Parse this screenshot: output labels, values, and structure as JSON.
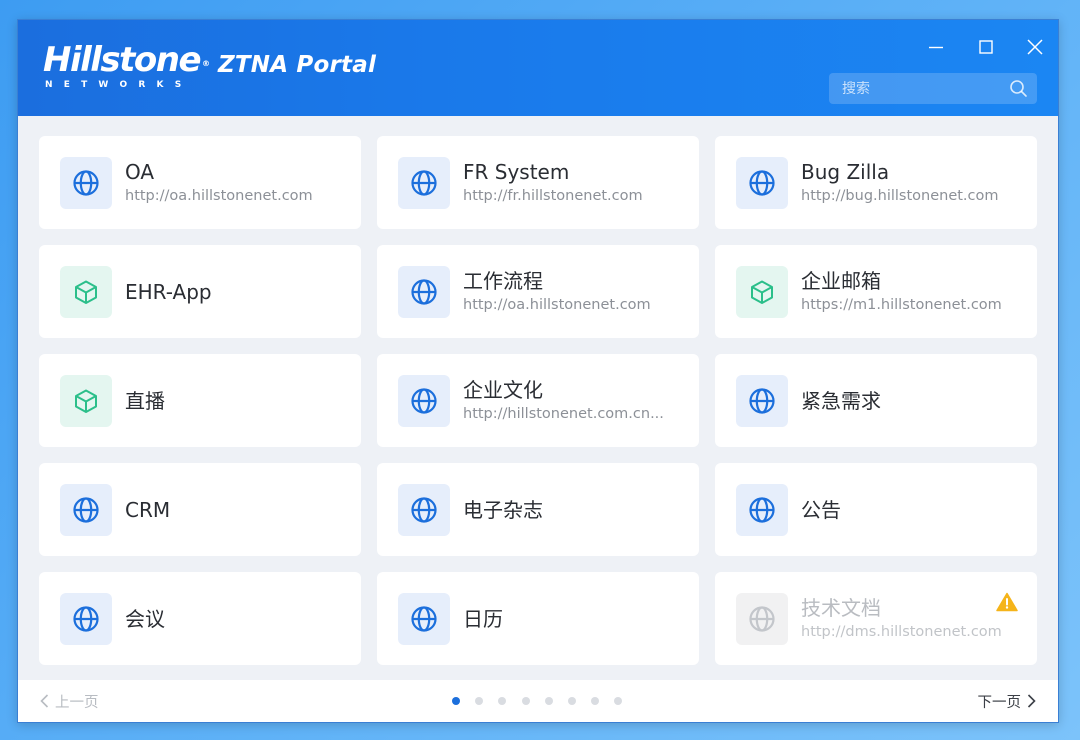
{
  "header": {
    "logo_text": "Hillstone",
    "logo_reg": "®",
    "logo_subtext": "NETWORKS",
    "portal_title": "ZTNA Portal",
    "search_placeholder": "搜索"
  },
  "apps": [
    {
      "name": "OA",
      "url": "http://oa.hillstonenet.com",
      "icon": "globe-icon",
      "kind": "web",
      "status": "normal"
    },
    {
      "name": "FR System",
      "url": "http://fr.hillstonenet.com",
      "icon": "globe-icon",
      "kind": "web",
      "status": "normal"
    },
    {
      "name": "Bug Zilla",
      "url": "http://bug.hillstonenet.com",
      "icon": "globe-icon",
      "kind": "web",
      "status": "normal"
    },
    {
      "name": "EHR-App",
      "url": "",
      "icon": "cube-icon",
      "kind": "app",
      "status": "normal"
    },
    {
      "name": "工作流程",
      "url": "http://oa.hillstonenet.com",
      "icon": "globe-icon",
      "kind": "web",
      "status": "normal"
    },
    {
      "name": "企业邮箱",
      "url": "https://m1.hillstonenet.com",
      "icon": "cube-icon",
      "kind": "app",
      "status": "normal"
    },
    {
      "name": "直播",
      "url": "",
      "icon": "cube-icon",
      "kind": "app",
      "status": "normal"
    },
    {
      "name": "企业文化",
      "url": "http://hillstonenet.com.cn...",
      "icon": "globe-icon",
      "kind": "web",
      "status": "normal"
    },
    {
      "name": "紧急需求",
      "url": "",
      "icon": "globe-icon",
      "kind": "web",
      "status": "normal"
    },
    {
      "name": "CRM",
      "url": "",
      "icon": "globe-icon",
      "kind": "web",
      "status": "normal"
    },
    {
      "name": "电子杂志",
      "url": "",
      "icon": "globe-icon",
      "kind": "web",
      "status": "normal"
    },
    {
      "name": "公告",
      "url": "",
      "icon": "globe-icon",
      "kind": "web",
      "status": "normal"
    },
    {
      "name": "会议",
      "url": "",
      "icon": "globe-icon",
      "kind": "web",
      "status": "normal"
    },
    {
      "name": "日历",
      "url": "",
      "icon": "globe-icon",
      "kind": "web",
      "status": "normal"
    },
    {
      "name": "技术文档",
      "url": "http://dms.hillstonenet.com",
      "icon": "globe-icon",
      "kind": "disabled",
      "status": "warning"
    }
  ],
  "pagination": {
    "prev_label": "上一页",
    "next_label": "下一页",
    "pages": 8,
    "current_page": 1
  },
  "colors": {
    "header_blue": "#1a79ea",
    "web_icon_blue": "#1c6fdc",
    "app_icon_green": "#2bbf8a",
    "warning_amber": "#f5b41a",
    "disabled_gray": "#c3c6cb"
  }
}
